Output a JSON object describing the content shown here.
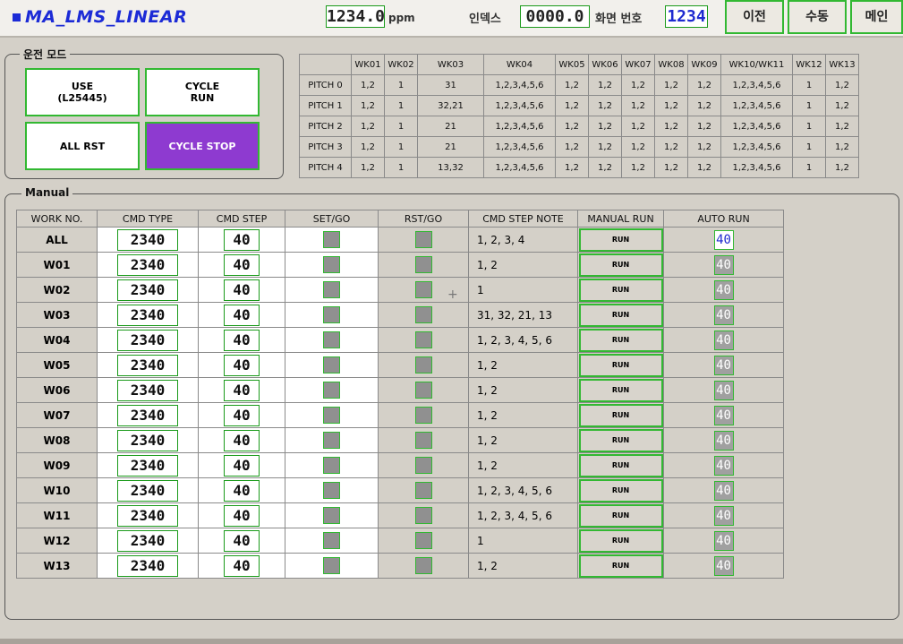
{
  "header": {
    "title": "MA_LMS_LINEAR",
    "ppm_value": "1234.0",
    "ppm_unit": "ppm",
    "index_label": "인덱스",
    "index_value": "0000.0",
    "screen_label": "화면 번호",
    "screen_value": "1234",
    "buttons": {
      "prev": "이전",
      "manual": "수동",
      "main": "메인"
    }
  },
  "run_mode": {
    "title": "운전 모드",
    "use_label": "USE",
    "use_sub": "(L25445)",
    "cycle_run_l1": "CYCLE",
    "cycle_run_l2": "RUN",
    "all_rst": "ALL RST",
    "cycle_stop": "CYCLE STOP"
  },
  "pitch_table": {
    "headers": [
      "",
      "WK01",
      "WK02",
      "WK03",
      "WK04",
      "WK05",
      "WK06",
      "WK07",
      "WK08",
      "WK09",
      "WK10/WK11",
      "WK12",
      "WK13"
    ],
    "rows": [
      [
        "PITCH 0",
        "1,2",
        "1",
        "31",
        "1,2,3,4,5,6",
        "1,2",
        "1,2",
        "1,2",
        "1,2",
        "1,2",
        "1,2,3,4,5,6",
        "1",
        "1,2"
      ],
      [
        "PITCH 1",
        "1,2",
        "1",
        "32,21",
        "1,2,3,4,5,6",
        "1,2",
        "1,2",
        "1,2",
        "1,2",
        "1,2",
        "1,2,3,4,5,6",
        "1",
        "1,2"
      ],
      [
        "PITCH 2",
        "1,2",
        "1",
        "21",
        "1,2,3,4,5,6",
        "1,2",
        "1,2",
        "1,2",
        "1,2",
        "1,2",
        "1,2,3,4,5,6",
        "1",
        "1,2"
      ],
      [
        "PITCH 3",
        "1,2",
        "1",
        "21",
        "1,2,3,4,5,6",
        "1,2",
        "1,2",
        "1,2",
        "1,2",
        "1,2",
        "1,2,3,4,5,6",
        "1",
        "1,2"
      ],
      [
        "PITCH 4",
        "1,2",
        "1",
        "13,32",
        "1,2,3,4,5,6",
        "1,2",
        "1,2",
        "1,2",
        "1,2",
        "1,2",
        "1,2,3,4,5,6",
        "1",
        "1,2"
      ]
    ]
  },
  "manual": {
    "title": "Manual",
    "headers": [
      "WORK NO.",
      "CMD TYPE",
      "CMD STEP",
      "SET/GO",
      "RST/GO",
      "CMD STEP NOTE",
      "MANUAL RUN",
      "AUTO RUN"
    ],
    "rows": [
      {
        "work": "ALL",
        "cmd_type": "2340",
        "cmd_step": "40",
        "note": "1, 2, 3, 4",
        "run": "RUN",
        "auto": "40"
      },
      {
        "work": "W01",
        "cmd_type": "2340",
        "cmd_step": "40",
        "note": "1, 2",
        "run": "RUN",
        "auto": "40"
      },
      {
        "work": "W02",
        "cmd_type": "2340",
        "cmd_step": "40",
        "note": "1",
        "run": "RUN",
        "auto": "40"
      },
      {
        "work": "W03",
        "cmd_type": "2340",
        "cmd_step": "40",
        "note": "31, 32, 21, 13",
        "run": "RUN",
        "auto": "40"
      },
      {
        "work": "W04",
        "cmd_type": "2340",
        "cmd_step": "40",
        "note": "1, 2, 3, 4, 5, 6",
        "run": "RUN",
        "auto": "40"
      },
      {
        "work": "W05",
        "cmd_type": "2340",
        "cmd_step": "40",
        "note": "1, 2",
        "run": "RUN",
        "auto": "40"
      },
      {
        "work": "W06",
        "cmd_type": "2340",
        "cmd_step": "40",
        "note": "1, 2",
        "run": "RUN",
        "auto": "40"
      },
      {
        "work": "W07",
        "cmd_type": "2340",
        "cmd_step": "40",
        "note": "1, 2",
        "run": "RUN",
        "auto": "40"
      },
      {
        "work": "W08",
        "cmd_type": "2340",
        "cmd_step": "40",
        "note": "1, 2",
        "run": "RUN",
        "auto": "40"
      },
      {
        "work": "W09",
        "cmd_type": "2340",
        "cmd_step": "40",
        "note": "1, 2",
        "run": "RUN",
        "auto": "40"
      },
      {
        "work": "W10",
        "cmd_type": "2340",
        "cmd_step": "40",
        "note": "1, 2, 3, 4, 5, 6",
        "run": "RUN",
        "auto": "40"
      },
      {
        "work": "W11",
        "cmd_type": "2340",
        "cmd_step": "40",
        "note": "1, 2, 3, 4, 5, 6",
        "run": "RUN",
        "auto": "40"
      },
      {
        "work": "W12",
        "cmd_type": "2340",
        "cmd_step": "40",
        "note": "1",
        "run": "RUN",
        "auto": "40"
      },
      {
        "work": "W13",
        "cmd_type": "2340",
        "cmd_step": "40",
        "note": "1, 2",
        "run": "RUN",
        "auto": "40"
      }
    ]
  },
  "colors": {
    "title": "#1c2bd6",
    "accent_border": "#32b832",
    "cycle_stop": "#8e3ad0",
    "indicator": "#909090",
    "panel": "#d4d0c8"
  }
}
